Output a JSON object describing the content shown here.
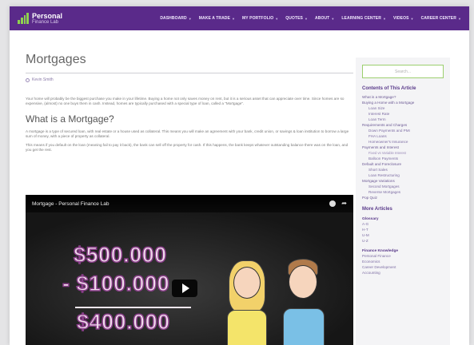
{
  "header": {
    "logo_line1": "Personal",
    "logo_line2": "Finance Lab",
    "nav": [
      {
        "label": "DASHBOARD"
      },
      {
        "label": "MAKE A TRADE"
      },
      {
        "label": "MY PORTFOLIO"
      },
      {
        "label": "QUOTES"
      },
      {
        "label": "ABOUT"
      },
      {
        "label": "LEARNING CENTER"
      },
      {
        "label": "VIDEOS"
      },
      {
        "label": "CAREER CENTER"
      }
    ]
  },
  "article": {
    "title": "Mortgages",
    "author": "Kevin Smith",
    "intro": "Your home will probably be the biggest purchase you make in your lifetime. Buying a home not only saves money on rent, but it is a serious asset that can appreciate over time. Since homes are so expensive, (almost) no one buys them in cash. Instead, homes are typically purchased with a special type of loan, called a \"Mortgage\".",
    "section_title": "What is a Mortgage?",
    "p1": "A mortgage is a type of secured loan, with real estate or a house used as collateral. This means you will make an agreement with your bank, credit union, or savings & loan institution to borrow a large sum of money, with a piece of property as collateral.",
    "p2": "This means if you default on the loan (meaning fail to pay it back), the bank can sell off the property for cash. If this happens, the bank keeps whatever outstanding balance there was on the loan, and you get the rest."
  },
  "video": {
    "title": "Mortgage - Personal Finance Lab",
    "amount1": "$500.000",
    "amount2": "- $100.000",
    "amount3": "$400.000"
  },
  "sidebar": {
    "search_placeholder": "Search...",
    "toc_title": "Contents of This Article",
    "toc": [
      {
        "label": "What is a Mortgage?",
        "level": 0
      },
      {
        "label": "Buying a Home with a Mortgage",
        "level": 0
      },
      {
        "label": "Loan Size",
        "level": 1
      },
      {
        "label": "Interest Rate",
        "level": 1
      },
      {
        "label": "Loan Term",
        "level": 1
      },
      {
        "label": "Requirements and Charges",
        "level": 0
      },
      {
        "label": "Down Payments and PMI",
        "level": 1
      },
      {
        "label": "FHA Loans",
        "level": 1
      },
      {
        "label": "Homeowner's Insurance",
        "level": 1
      },
      {
        "label": "Payments and Interest",
        "level": 0
      },
      {
        "label": "Fixed vs Variable Interest",
        "level": 2
      },
      {
        "label": "Balloon Payments",
        "level": 1
      },
      {
        "label": "Default and Foreclosure",
        "level": 0
      },
      {
        "label": "Short Sales",
        "level": 1
      },
      {
        "label": "Loan Restructuring",
        "level": 1
      },
      {
        "label": "Mortgage Variations",
        "level": 0
      },
      {
        "label": "Second Mortgages",
        "level": 1
      },
      {
        "label": "Reverse Mortgages",
        "level": 1
      },
      {
        "label": "Pop Quiz",
        "level": 0
      }
    ],
    "more_title": "More Articles",
    "glossary_title": "Glossary",
    "glossary": [
      "A-G",
      "H-T",
      "U-M",
      "U-Z"
    ],
    "finance_title": "Finance Knowledge",
    "finance": [
      "Personal Finance",
      "Economics",
      "Career Development",
      "Accounting"
    ]
  },
  "colors": {
    "header": "#5a2a8a",
    "accent_green": "#8fd14f",
    "link_purple": "#6c5a94"
  }
}
